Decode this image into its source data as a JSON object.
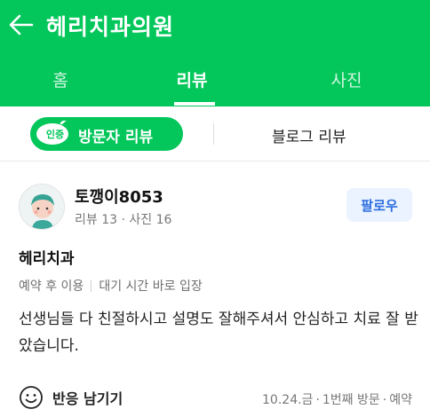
{
  "header": {
    "title": "헤리치과의원",
    "back_icon": "arrow-left-icon"
  },
  "tabs": [
    {
      "label": "홈"
    },
    {
      "label": "리뷰",
      "active": true
    },
    {
      "label": "사진"
    }
  ],
  "subtabs": {
    "certified_badge": "인증",
    "visit_review": "방문자 리뷰",
    "blog_review": "블로그 리뷰"
  },
  "review": {
    "author": "토깽이8053",
    "stats": "리뷰 13 · 사진 16",
    "follow_label": "팔로우",
    "place": "헤리치과",
    "tags": [
      "예약 후 이용",
      "대기 시간 바로 입장"
    ],
    "text": "선생님들 다 친절하시고 설명도 잘해주셔서 안심하고 치료 잘 받았습니다.",
    "react_label": "반응 남기기",
    "visit_date": "10.24.금",
    "visit_count": "1번째 방문",
    "visit_type": "예약"
  },
  "colors": {
    "brand": "#03c75a",
    "follow_text": "#2f6fe0",
    "follow_bg": "#eaf3ff"
  }
}
